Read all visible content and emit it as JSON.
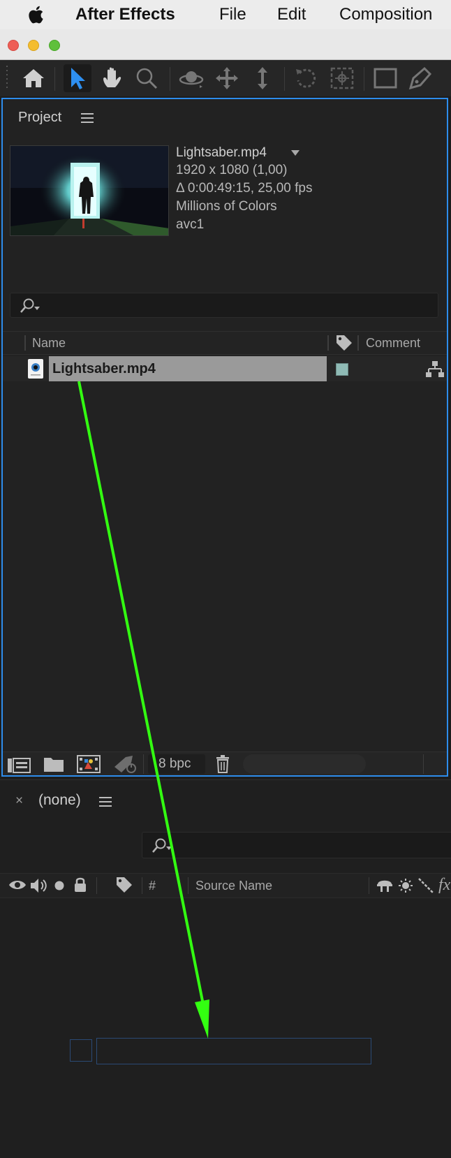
{
  "menubar": {
    "app_name": "After Effects",
    "items": [
      "File",
      "Edit",
      "Composition"
    ]
  },
  "toolbar": {
    "tools": [
      "home-icon",
      "selection-tool-icon",
      "hand-tool-icon",
      "zoom-tool-icon",
      "orbit-camera-icon",
      "pan-camera-icon",
      "dolly-camera-icon",
      "rotation-tool-icon",
      "anchor-point-tool-icon",
      "rectangle-tool-icon",
      "pen-tool-icon"
    ],
    "active_tool": "selection-tool-icon"
  },
  "project": {
    "tab_label": "Project",
    "footage": {
      "name": "Lightsaber.mp4",
      "resolution": "1920 x 1080 (1,00)",
      "duration": "Δ 0:00:49:15, 25,00 fps",
      "color_depth": "Millions of Colors",
      "codec": "avc1"
    },
    "columns": {
      "name": "Name",
      "comment": "Comment"
    },
    "items": [
      {
        "name": "Lightsaber.mp4",
        "label_color": "#8fbab5",
        "selected": true
      }
    ],
    "footer": {
      "bit_depth": "8 bpc"
    }
  },
  "timeline": {
    "tab_label": "(none)",
    "close_label": "×",
    "columns": {
      "number": "#",
      "source_name": "Source Name",
      "fx": "fx"
    }
  },
  "colors": {
    "accent_blue": "#2d8ceb",
    "arrow_green": "#33ff11",
    "panel_bg": "#222222"
  },
  "annotation": {
    "type": "drag-arrow",
    "color": "#33ff11"
  }
}
